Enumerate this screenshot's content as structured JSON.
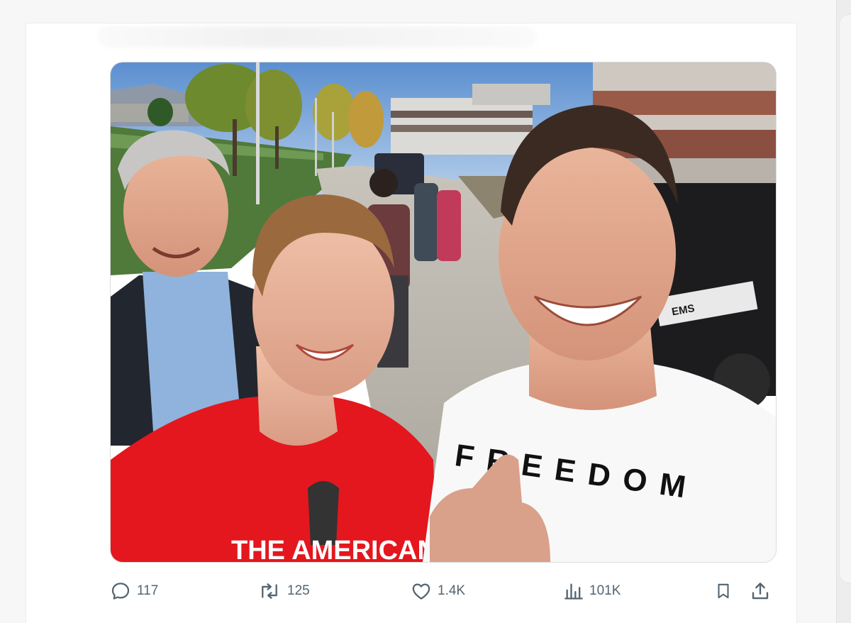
{
  "post": {
    "image": {
      "alt": "Selfie of three men outdoors on a campus walkway",
      "shirt_text_left": "THE AMERICAN",
      "shirt_text_right": "FREEDOM",
      "vehicle_text": "EMS"
    },
    "actions": {
      "replies": {
        "icon": "reply-icon",
        "count": "117"
      },
      "reposts": {
        "icon": "repost-icon",
        "count": "125"
      },
      "likes": {
        "icon": "heart-icon",
        "count": "1.4K"
      },
      "views": {
        "icon": "views-icon",
        "count": "101K"
      },
      "bookmark": {
        "icon": "bookmark-icon"
      },
      "share": {
        "icon": "share-icon"
      }
    }
  },
  "colors": {
    "icon_gray": "#536471",
    "sky": "#6fa0d8",
    "grass": "#4f7a3a",
    "red_shirt": "#e4171e",
    "white_shirt": "#f8f8f8"
  }
}
